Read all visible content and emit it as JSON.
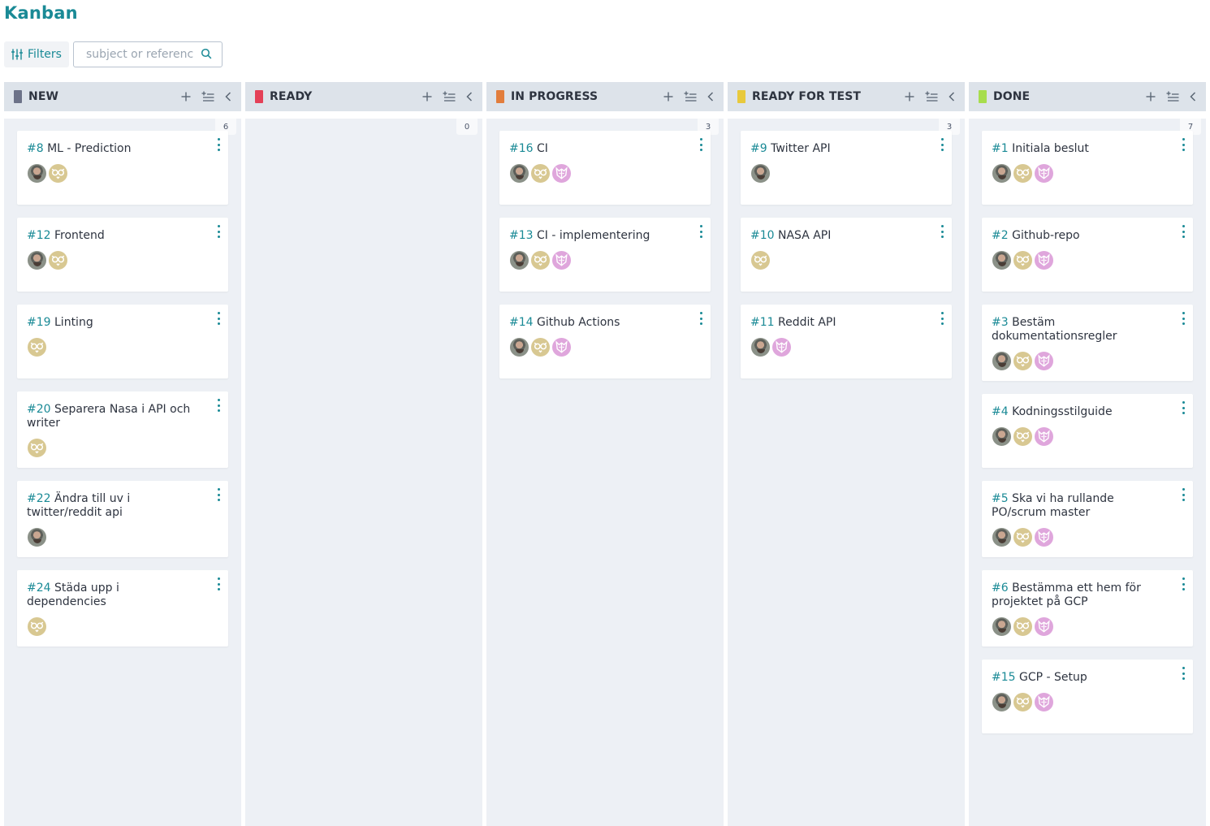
{
  "page_title": "Kanban",
  "toolbar": {
    "filters_label": "Filters",
    "search_placeholder": "subject or reference"
  },
  "colors": {
    "accent": "#1a8a96",
    "new": "#6c7288",
    "ready": "#e44057",
    "in_progress": "#e27d3c",
    "ready_for_test": "#e8c93c",
    "done": "#a7dd4d"
  },
  "columns": [
    {
      "name": "NEW",
      "count": "6",
      "color": "#6c7288",
      "cards": [
        {
          "ref": "#8",
          "title": "ML - Prediction",
          "avatars": [
            "photo",
            "owl"
          ]
        },
        {
          "ref": "#12",
          "title": "Frontend",
          "avatars": [
            "photo",
            "owl"
          ]
        },
        {
          "ref": "#19",
          "title": "Linting",
          "avatars": [
            "owl"
          ]
        },
        {
          "ref": "#20",
          "title": "Separera Nasa i API och writer",
          "avatars": [
            "owl"
          ]
        },
        {
          "ref": "#22",
          "title": "Ändra till uv i twitter/reddit api",
          "avatars": [
            "photo"
          ]
        },
        {
          "ref": "#24",
          "title": "Städa upp i dependencies",
          "avatars": [
            "owl"
          ]
        }
      ]
    },
    {
      "name": "READY",
      "count": "0",
      "color": "#e44057",
      "cards": []
    },
    {
      "name": "IN PROGRESS",
      "count": "3",
      "color": "#e27d3c",
      "cards": [
        {
          "ref": "#16",
          "title": "CI",
          "avatars": [
            "photo",
            "owl",
            "pink"
          ]
        },
        {
          "ref": "#13",
          "title": "CI - implementering",
          "avatars": [
            "photo",
            "owl",
            "pink"
          ]
        },
        {
          "ref": "#14",
          "title": "Github Actions",
          "avatars": [
            "photo",
            "owl",
            "pink"
          ]
        }
      ]
    },
    {
      "name": "READY FOR TEST",
      "count": "3",
      "color": "#e8c93c",
      "cards": [
        {
          "ref": "#9",
          "title": "Twitter API",
          "avatars": [
            "photo"
          ]
        },
        {
          "ref": "#10",
          "title": "NASA API",
          "avatars": [
            "owl"
          ]
        },
        {
          "ref": "#11",
          "title": "Reddit API",
          "avatars": [
            "photo",
            "pink"
          ]
        }
      ]
    },
    {
      "name": "DONE",
      "count": "7",
      "color": "#a7dd4d",
      "cards": [
        {
          "ref": "#1",
          "title": "Initiala beslut",
          "avatars": [
            "photo",
            "owl",
            "pink"
          ]
        },
        {
          "ref": "#2",
          "title": "Github-repo",
          "avatars": [
            "photo",
            "owl",
            "pink"
          ]
        },
        {
          "ref": "#3",
          "title": "Bestäm dokumentationsregler",
          "avatars": [
            "photo",
            "owl",
            "pink"
          ]
        },
        {
          "ref": "#4",
          "title": "Kodningsstilguide",
          "avatars": [
            "photo",
            "owl",
            "pink"
          ]
        },
        {
          "ref": "#5",
          "title": "Ska vi ha rullande PO/scrum master",
          "avatars": [
            "photo",
            "owl",
            "pink"
          ]
        },
        {
          "ref": "#6",
          "title": "Bestämma ett hem för projektet på GCP",
          "avatars": [
            "photo",
            "owl",
            "pink"
          ]
        },
        {
          "ref": "#15",
          "title": "GCP - Setup",
          "avatars": [
            "photo",
            "owl",
            "pink"
          ]
        }
      ]
    }
  ],
  "icons": {
    "filters": "sliders-icon",
    "search": "search-icon",
    "add": "plus-icon",
    "bulk_add": "add-list-icon",
    "fold": "chevron-left-icon",
    "card_menu": "vertical-dots-icon"
  }
}
